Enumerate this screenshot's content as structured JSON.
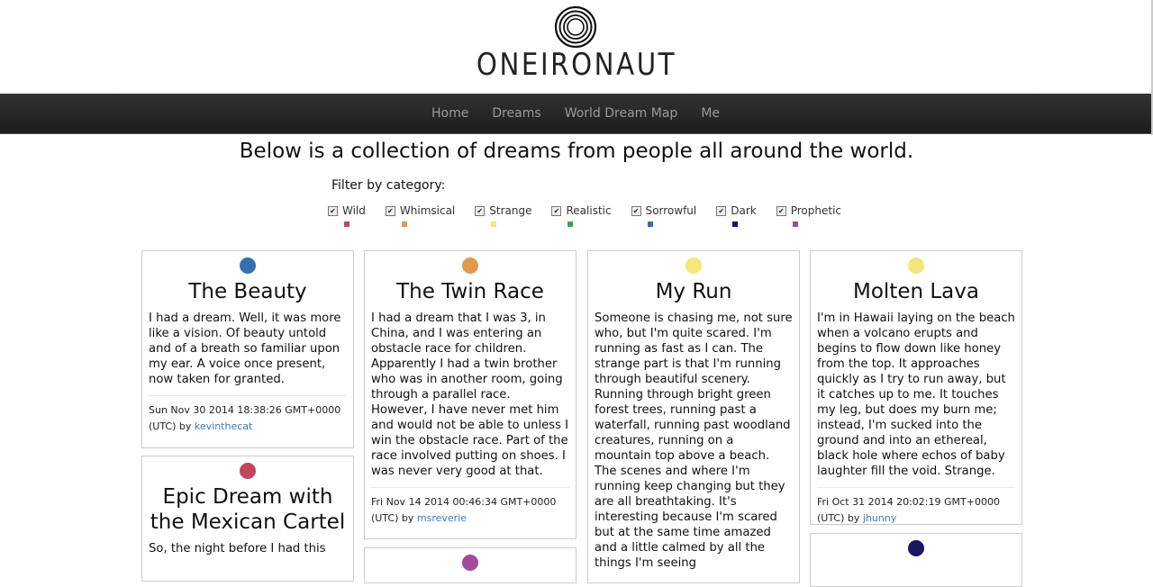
{
  "brand": {
    "name": "ONEIRONAUT"
  },
  "nav": [
    "Home",
    "Dreams",
    "World Dream Map",
    "Me"
  ],
  "intro": "Below is a collection of dreams from people all around the world.",
  "filter": {
    "label": "Filter by category:",
    "categories": [
      {
        "label": "Wild",
        "color": "#c0465a",
        "checked": true
      },
      {
        "label": "Whimsical",
        "color": "#e09a4e",
        "checked": true
      },
      {
        "label": "Strange",
        "color": "#f4e57c",
        "checked": true
      },
      {
        "label": "Realistic",
        "color": "#3aa35a",
        "checked": true
      },
      {
        "label": "Sorrowful",
        "color": "#3670b2",
        "checked": true
      },
      {
        "label": "Dark",
        "color": "#1a1660",
        "checked": true
      },
      {
        "label": "Prophetic",
        "color": "#a44a9a",
        "checked": true
      }
    ]
  },
  "dreams": [
    {
      "title": "The Beauty",
      "color": "#3670b2",
      "body": "I had a dream. Well, it was more like a vision. Of beauty untold and of a breath so familiar upon my ear. A voice once present, now taken for granted.",
      "date": "Sun Nov 30 2014 18:38:26 GMT+0000 (UTC)",
      "by": "by",
      "author": "kevinthecat"
    },
    {
      "title": "Epic Dream with the Mexican Cartel",
      "color": "#c0465a",
      "body": "So, the night before I had this",
      "date": "",
      "by": "",
      "author": ""
    },
    {
      "title": "The Twin Race",
      "color": "#e09a4e",
      "body": "I had a dream that I was 3, in China, and I was entering an obstacle race for children. Apparently I had a twin brother who was in another room, going through a parallel race. However, I have never met him and would not be able to unless I win the obstacle race. Part of the race involved putting on shoes. I was never very good at that.",
      "date": "Fri Nov 14 2014 00:46:34 GMT+0000 (UTC)",
      "by": "by",
      "author": "msreverie"
    },
    {
      "title": "",
      "color": "#a44a9a",
      "body": "",
      "date": "",
      "by": "",
      "author": ""
    },
    {
      "title": "My Run",
      "color": "#f4e57c",
      "body": "Someone is chasing me, not sure who, but I'm quite scared. I'm running as fast as I can. The strange part is that I'm running through beautiful scenery. Running through bright green forest trees, running past a waterfall, running past woodland creatures, running on a mountain top above a beach. The scenes and where I'm running keep changing but they are all breathtaking. It's interesting because I'm scared but at the same time amazed and a little calmed by all the things I'm seeing",
      "date": "",
      "by": "",
      "author": ""
    },
    {
      "title": "Molten Lava",
      "color": "#f4e57c",
      "body": "I'm in Hawaii laying on the beach when a volcano erupts and begins to flow down like honey from the top. It approaches quickly as I try to run away, but it catches up to me. It touches my leg, but does my burn me; instead, I'm sucked into the ground and into an ethereal, black hole where echos of baby laughter fill the void. Strange.",
      "date": "Fri Oct 31 2014 20:02:19 GMT+0000 (UTC)",
      "by": "by",
      "author": "jhunny"
    },
    {
      "title": "",
      "color": "#1a1660",
      "body": "",
      "date": "",
      "by": "",
      "author": ""
    }
  ]
}
